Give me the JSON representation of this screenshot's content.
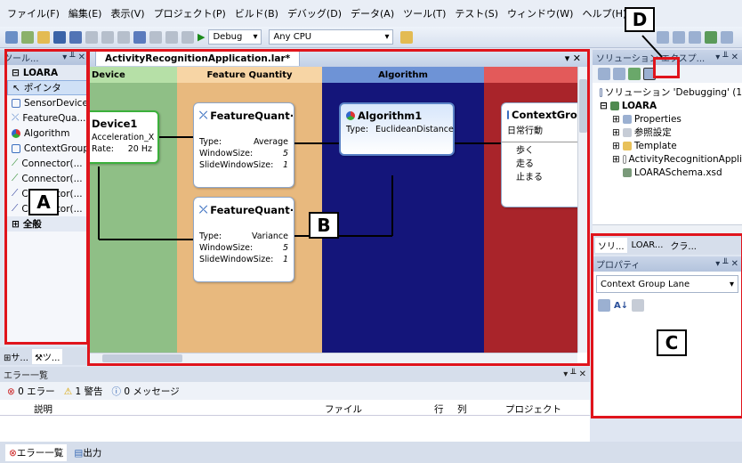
{
  "menu": {
    "items": [
      "ファイル(F)",
      "編集(E)",
      "表示(V)",
      "プロジェクト(P)",
      "ビルド(B)",
      "デバッグ(D)",
      "データ(A)",
      "ツール(T)",
      "テスト(S)",
      "ウィンドウ(W)",
      "ヘルプ(H)"
    ]
  },
  "toolbar": {
    "config": "Debug",
    "platform": "Any CPU"
  },
  "toolbox": {
    "title": "ツール...",
    "group": "LOARA",
    "items": [
      "ポインタ",
      "SensorDevice",
      "FeatureQua...",
      "Algorithm",
      "ContextGroup",
      "Connector(...",
      "Connector(...",
      "Connector(...",
      "Connector(..."
    ],
    "general": "全般",
    "tab1": "サ...",
    "tab2": "ツ..."
  },
  "designer": {
    "tab": "ActivityRecognitionApplication.lar*",
    "lanes": [
      "Device",
      "Feature Quantity",
      "Algorithm",
      ""
    ],
    "device_node": {
      "title": "Device1",
      "prop1_label": "Acceleration_X",
      "prop2_label": "Rate:",
      "prop2_value": "20 Hz"
    },
    "fq1": {
      "title": "FeatureQuant···",
      "type_label": "Type:",
      "type_value": "Average",
      "ws_label": "WindowSize:",
      "ws_value": "5",
      "sws_label": "SlideWindowSize:",
      "sws_value": "1"
    },
    "fq2": {
      "title": "FeatureQuant···",
      "type_label": "Type:",
      "type_value": "Variance",
      "ws_label": "WindowSize:",
      "ws_value": "5",
      "sws_label": "SlideWindowSize:",
      "sws_value": "1"
    },
    "algo": {
      "title": "Algorithm1",
      "type_label": "Type:",
      "type_value": "EuclideanDistance"
    },
    "context": {
      "title": "ContextGrou",
      "subtitle": "日常行動",
      "items": [
        "歩く",
        "走る",
        "止まる"
      ]
    }
  },
  "solution": {
    "title": "ソリューション エクスプ...",
    "root": "ソリューション 'Debugging' (1",
    "project": "LOARA",
    "items": [
      "Properties",
      "参照設定",
      "Template",
      "ActivityRecognitionAppli",
      "LOARASchema.xsd"
    ],
    "tabs": [
      "ソリ...",
      "LOAR...",
      "クラ..."
    ]
  },
  "properties": {
    "title": "プロパティ",
    "selected": "Context Group Lane"
  },
  "errorlist": {
    "title": "エラー一覧",
    "errors": "0 エラー",
    "warnings": "1 警告",
    "messages": "0 メッセージ",
    "columns": [
      "説明",
      "ファイル",
      "行",
      "列",
      "プロジェクト"
    ]
  },
  "bottom_tabs": [
    "エラー一覧",
    "出力"
  ],
  "annotations": {
    "a": "A",
    "b": "B",
    "c": "C",
    "d": "D"
  },
  "colors": {
    "device_lane": "#8fbf86",
    "fq_lane": "#e8b97e",
    "algo_lane": "#14157a",
    "ctx_lane": "#a9242a",
    "highlight": "#e0141c"
  }
}
